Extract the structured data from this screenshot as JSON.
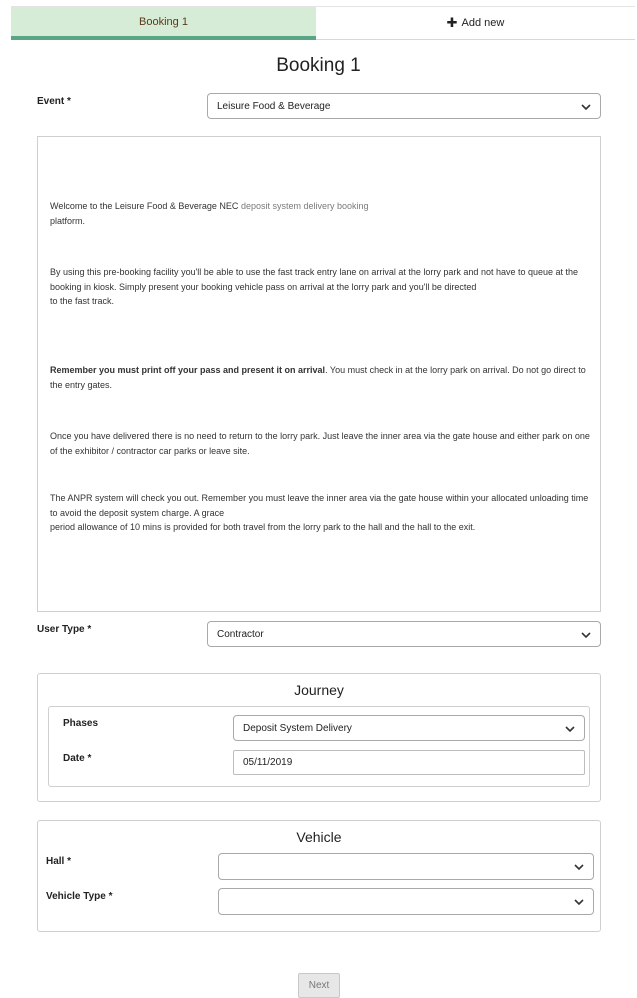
{
  "tabs": {
    "active_label": "Booking 1",
    "add_label": "Add new",
    "add_icon": "plus-icon"
  },
  "page_title": "Booking 1",
  "event": {
    "label": "Event *",
    "value": "Leisure Food & Beverage"
  },
  "info": {
    "p1a": "Welcome to the Leisure Food & Beverage NEC ",
    "p1b": "deposit system delivery booking",
    "p1c": "platform.",
    "p2": "By using this pre-booking facility you'll be able to use the fast track entry lane on arrival at the lorry park and not have to queue at the booking in kiosk. Simply present your booking vehicle pass on arrival at the lorry park and you'll be directed",
    "p2b": "to the fast track.",
    "p3_bold": "Remember you must print off your pass and present it on arrival",
    "p3_rest": ". You must check in at the lorry park on arrival. Do not go direct to the entry gates.",
    "p4": "Once you have delivered there is no need to return to the lorry park. Just leave the inner area via the gate house and either park on one of the exhibitor / contractor  car parks or leave site.",
    "p5": "The ANPR system will check you out. Remember you must leave the inner area via the gate house within your allocated unloading time to avoid the deposit system charge. A grace",
    "p5b": "period allowance of 10 mins is provided for both travel from the lorry park to the hall and the hall to the exit."
  },
  "user_type": {
    "label": "User Type *",
    "value": "Contractor"
  },
  "journey": {
    "title": "Journey",
    "phases_label": "Phases",
    "phases_value": "Deposit System Delivery",
    "date_label": "Date *",
    "date_value": "05/11/2019"
  },
  "vehicle": {
    "title": "Vehicle",
    "hall_label": "Hall *",
    "hall_value": "",
    "type_label": "Vehicle Type *",
    "type_value": ""
  },
  "next_label": "Next"
}
